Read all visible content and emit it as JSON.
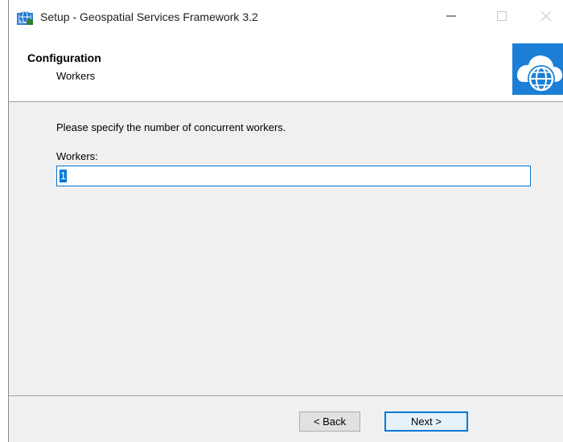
{
  "window": {
    "title": "Setup - Geospatial Services Framework 3.2",
    "app_icon": "installer-icon"
  },
  "titlebar_buttons": {
    "minimize_icon": "minimize-icon",
    "maximize_icon": "maximize-icon",
    "close_icon": "close-icon"
  },
  "header": {
    "title": "Configuration",
    "subtitle": "Workers",
    "logo": "cloud-globe-logo"
  },
  "content": {
    "prompt": "Please specify the number of concurrent workers.",
    "workers_label": "Workers:",
    "workers_value": "1"
  },
  "footer": {
    "back_label": "< Back",
    "next_label": "Next >"
  },
  "colors": {
    "accent": "#0078d7",
    "panel": "#f0f0f0"
  }
}
